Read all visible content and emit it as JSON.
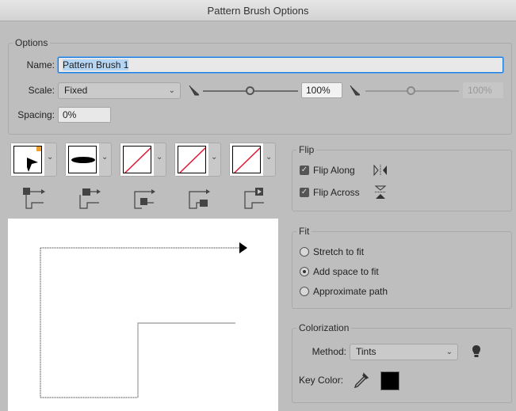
{
  "window": {
    "title": "Pattern Brush Options"
  },
  "options": {
    "legend": "Options",
    "name_label": "Name:",
    "name_value": "Pattern Brush 1",
    "scale_label": "Scale:",
    "scale_value": "Fixed",
    "scale_min": "100%",
    "scale_max": "100%",
    "scale_min_fraction": 0.5,
    "scale_max_fraction": 0.5,
    "spacing_label": "Spacing:",
    "spacing_value": "0%"
  },
  "tiles": [
    {
      "name": "outer-corner",
      "icon": "outer-corner-tile-icon"
    },
    {
      "name": "side",
      "icon": "side-tile-icon"
    },
    {
      "name": "inner-corner",
      "icon": "inner-corner-tile-icon"
    },
    {
      "name": "end",
      "icon": "end-tile-icon"
    },
    {
      "name": "start",
      "icon": "start-tile-icon"
    }
  ],
  "flip": {
    "legend": "Flip",
    "along_label": "Flip Along",
    "along_checked": true,
    "across_label": "Flip Across",
    "across_checked": true
  },
  "fit": {
    "legend": "Fit",
    "options": [
      "Stretch to fit",
      "Add space to fit",
      "Approximate path"
    ],
    "selected": 1
  },
  "colorization": {
    "legend": "Colorization",
    "method_label": "Method:",
    "method_value": "Tints",
    "key_color_label": "Key Color:",
    "key_color": "#000000"
  },
  "colors": {
    "accent": "#1a7ad9",
    "selection": "#b5d5f5",
    "tile_slash": "#e01b38",
    "corner_marker": "#f0a030"
  }
}
